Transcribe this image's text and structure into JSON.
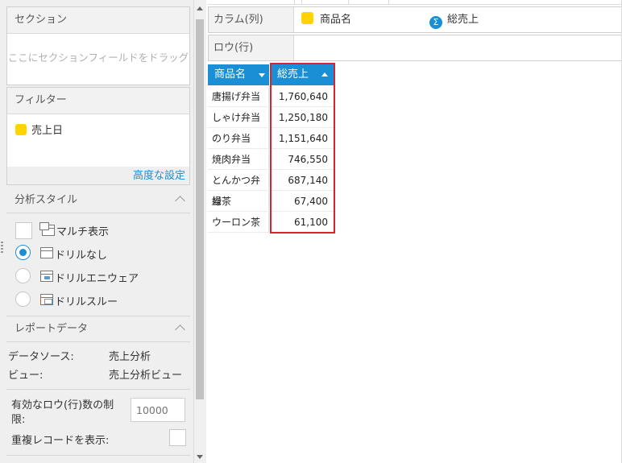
{
  "left_panel": {
    "section": {
      "title": "セクション",
      "placeholder": "ここにセクションフィールドをドラッグ"
    },
    "filter": {
      "title": "フィルター",
      "field": "売上日",
      "advanced_link": "高度な設定"
    },
    "analysis_style": {
      "title": "分析スタイル",
      "options": [
        {
          "label": "マルチ表示",
          "selected": false
        },
        {
          "label": "ドリルなし",
          "selected": true
        },
        {
          "label": "ドリルエニウェア",
          "selected": false
        },
        {
          "label": "ドリルスルー",
          "selected": false
        }
      ]
    },
    "report_data": {
      "title": "レポートデータ",
      "datasource_label": "データソース:",
      "datasource_value": "売上分析",
      "view_label": "ビュー:",
      "view_value": "売上分析ビュー",
      "row_limit_label_1": "有効なロウ(行)数の制",
      "row_limit_label_2": "限:",
      "row_limit_placeholder": "10000",
      "show_duplicates_label": "重複レコードを表示:"
    }
  },
  "drop_zones": {
    "columns_label": "カラム(列)",
    "columns_fields": [
      {
        "label": "商品名",
        "icon": "dimension-yellow-icon",
        "color": "#ffd400"
      },
      {
        "label": "総売上",
        "icon": "sigma-icon",
        "color": "#1a8fd6"
      }
    ],
    "rows_label": "ロウ(行)"
  },
  "table": {
    "headers": [
      "商品名",
      "総売上"
    ],
    "rows": [
      [
        "唐揚げ弁当",
        "1,760,640"
      ],
      [
        "しゃけ弁当",
        "1,250,180"
      ],
      [
        "のり弁当",
        "1,151,640"
      ],
      [
        "焼肉弁当",
        "746,550"
      ],
      [
        "とんかつ弁当",
        "687,140"
      ],
      [
        "緑茶",
        "67,400"
      ],
      [
        "ウーロン茶",
        "61,100"
      ]
    ]
  },
  "colors": {
    "accent": "#1a8fd6",
    "highlight_border": "#d9232d",
    "dimension": "#ffd400"
  }
}
